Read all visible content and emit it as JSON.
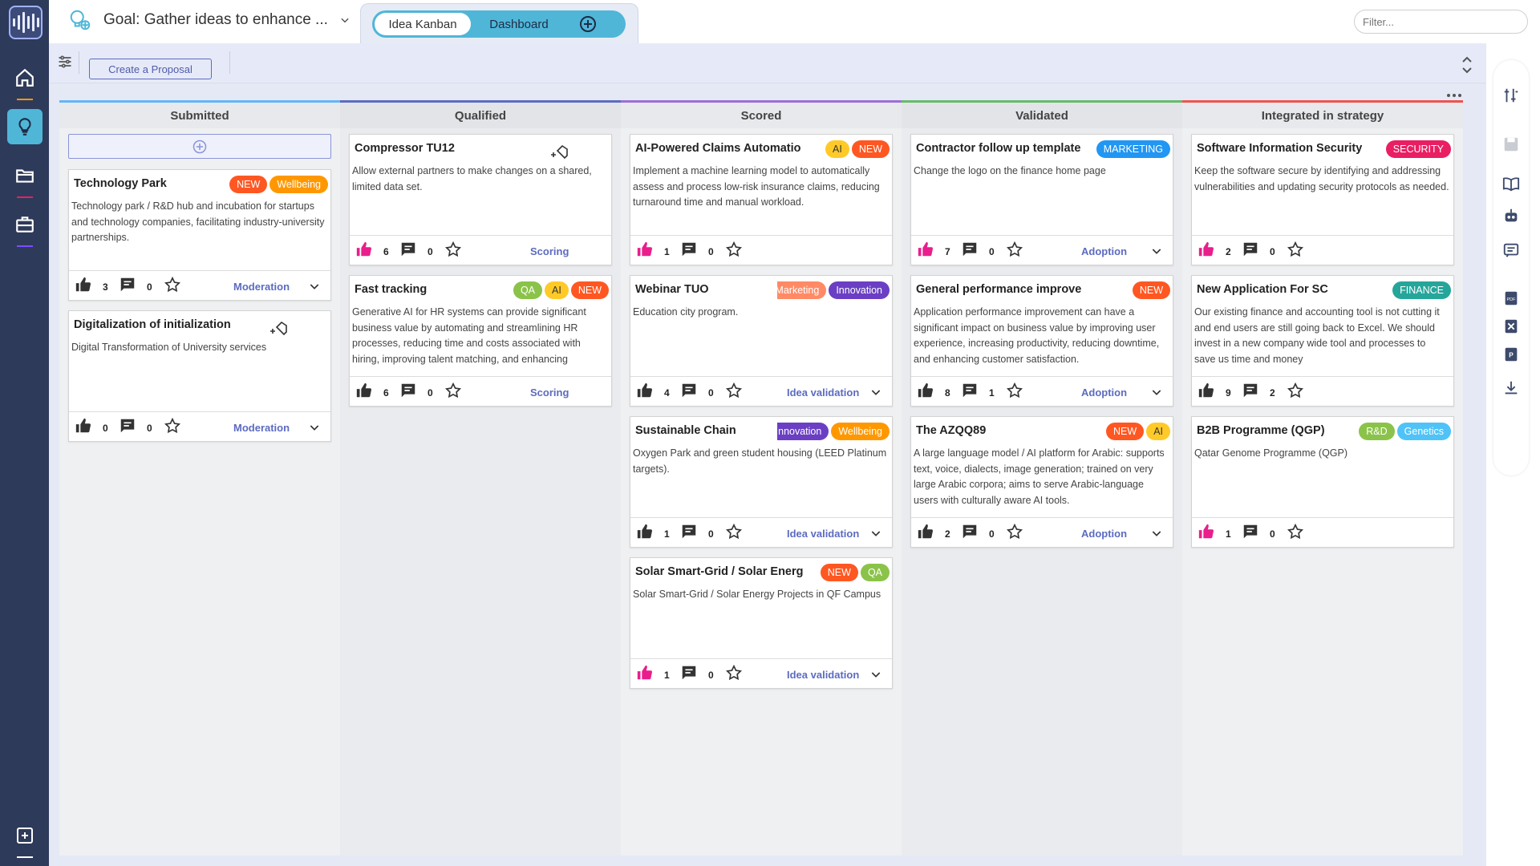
{
  "header": {
    "goal_title": "Goal: Gather ideas to enhance ...",
    "tabs": [
      "Idea Kanban",
      "Dashboard"
    ],
    "filter_placeholder": "Filter..."
  },
  "toolbar": {
    "create_label": "Create a Proposal"
  },
  "colors": {
    "accent": "#4fb6d8",
    "sidebar": "#2e3a59",
    "stage_link": "#5c6bc0"
  },
  "columns": [
    {
      "title": "Submitted",
      "color": "#64b5f6",
      "cards": [
        {
          "title": "Technology Park",
          "badges": [
            {
              "label": "NEW",
              "color": "#ff5722"
            },
            {
              "label": "Wellbeing",
              "color": "#ff9800"
            }
          ],
          "desc": "Technology park / R&D hub and incubation for startups and technology companies, facilitating industry-university partnerships.",
          "likes": "3",
          "comments": "0",
          "stage": "Moderation",
          "liked": false,
          "tag_icon": false
        },
        {
          "title": "Digitalization of initialization",
          "badges": [],
          "desc": "Digital Transformation of University services",
          "likes": "0",
          "comments": "0",
          "stage": "Moderation",
          "liked": false,
          "tag_icon": true
        }
      ]
    },
    {
      "title": "Qualified",
      "color": "#5c6bc0",
      "cards": [
        {
          "title": "Compressor TU12",
          "badges": [],
          "desc": "Allow external partners to make changes on a shared, limited data set.",
          "likes": "6",
          "comments": "0",
          "stage": "Scoring",
          "liked": true,
          "tag_icon": true
        },
        {
          "title": "Fast tracking",
          "badges": [
            {
              "label": "QA",
              "color": "#8bc34a"
            },
            {
              "label": "AI",
              "color": "#ffca28"
            },
            {
              "label": "NEW",
              "color": "#ff5722"
            }
          ],
          "desc": "Generative AI for HR systems can provide significant business value by automating and streamlining HR processes, reducing time and costs associated with hiring, improving talent matching, and enhancing",
          "likes": "6",
          "comments": "0",
          "stage": "Scoring",
          "liked": false,
          "tag_icon": false
        }
      ]
    },
    {
      "title": "Scored",
      "color": "#9c6fd6",
      "cards": [
        {
          "title": "AI-Powered Claims Automatio",
          "badges": [
            {
              "label": "AI",
              "color": "#ffca28"
            },
            {
              "label": "NEW",
              "color": "#ff5722"
            }
          ],
          "desc": "Implement a machine learning model to automatically assess and process low-risk insurance claims, reducing turnaround time and manual workload.",
          "likes": "1",
          "comments": "0",
          "stage": "",
          "liked": true,
          "tag_icon": false
        },
        {
          "title": "Webinar TUO",
          "badges": [
            {
              "label": "Marketing",
              "color": "#ff8a65"
            },
            {
              "label": "Innovation",
              "color": "#6a3fc4"
            }
          ],
          "desc": "Education city program.",
          "likes": "4",
          "comments": "0",
          "stage": "Idea validation",
          "liked": false,
          "tag_icon": false
        },
        {
          "title": "Sustainable Chain",
          "badges": [
            {
              "label": "Innovation",
              "color": "#6a3fc4"
            },
            {
              "label": "Wellbeing",
              "color": "#ff9800"
            }
          ],
          "desc": "Oxygen Park and green student housing (LEED Platinum targets).",
          "likes": "1",
          "comments": "0",
          "stage": "Idea validation",
          "liked": false,
          "tag_icon": false
        },
        {
          "title": "Solar Smart-Grid / Solar Energ",
          "badges": [
            {
              "label": "NEW",
              "color": "#ff5722"
            },
            {
              "label": "QA",
              "color": "#8bc34a"
            }
          ],
          "desc": "Solar Smart-Grid / Solar Energy Projects in QF Campus",
          "likes": "1",
          "comments": "0",
          "stage": "Idea validation",
          "liked": true,
          "tag_icon": false
        }
      ]
    },
    {
      "title": "Validated",
      "color": "#66bb6a",
      "cards": [
        {
          "title": "Contractor follow up template",
          "badges": [
            {
              "label": "MARKETING",
              "color": "#2196f3"
            }
          ],
          "desc": "Change the logo on the finance home page",
          "likes": "7",
          "comments": "0",
          "stage": "Adoption",
          "liked": true,
          "tag_icon": false
        },
        {
          "title": "General performance improve",
          "badges": [
            {
              "label": "NEW",
              "color": "#ff5722"
            }
          ],
          "desc": "Application performance improvement can have a significant impact on business value by improving user experience, increasing productivity, reducing downtime, and enhancing customer satisfaction.",
          "likes": "8",
          "comments": "1",
          "stage": "Adoption",
          "liked": false,
          "tag_icon": false
        },
        {
          "title": "The AZQQ89",
          "badges": [
            {
              "label": "NEW",
              "color": "#ff5722"
            },
            {
              "label": "AI",
              "color": "#ffca28"
            }
          ],
          "desc": "A large language model / AI platform for Arabic: supports text, voice, dialects, image generation; trained on very large Arabic corpora; aims to serve Arabic-language users with culturally aware AI tools.",
          "likes": "2",
          "comments": "0",
          "stage": "Adoption",
          "liked": false,
          "tag_icon": false
        }
      ]
    },
    {
      "title": "Integrated in strategy",
      "color": "#ef5350",
      "cards": [
        {
          "title": "Software Information Security",
          "badges": [
            {
              "label": "SECURITY",
              "color": "#e91e63"
            }
          ],
          "desc": "Keep the software secure by identifying and addressing vulnerabilities and updating security protocols as needed.",
          "likes": "2",
          "comments": "0",
          "stage": "",
          "liked": true,
          "tag_icon": false
        },
        {
          "title": "New Application For SC",
          "badges": [
            {
              "label": "FINANCE",
              "color": "#26a69a"
            }
          ],
          "desc": "Our existing finance and accounting tool is not cutting it and end users are still going back to Excel. We should invest in a new company wide tool and processes to save us time and money",
          "likes": "9",
          "comments": "2",
          "stage": "",
          "liked": false,
          "tag_icon": false
        },
        {
          "title": "B2B Programme (QGP)",
          "badges": [
            {
              "label": "R&D",
              "color": "#8bc34a"
            },
            {
              "label": "Genetics",
              "color": "#4fc3f7"
            }
          ],
          "desc": "Qatar Genome Programme (QGP)",
          "likes": "1",
          "comments": "0",
          "stage": "",
          "liked": true,
          "tag_icon": false
        }
      ]
    }
  ]
}
